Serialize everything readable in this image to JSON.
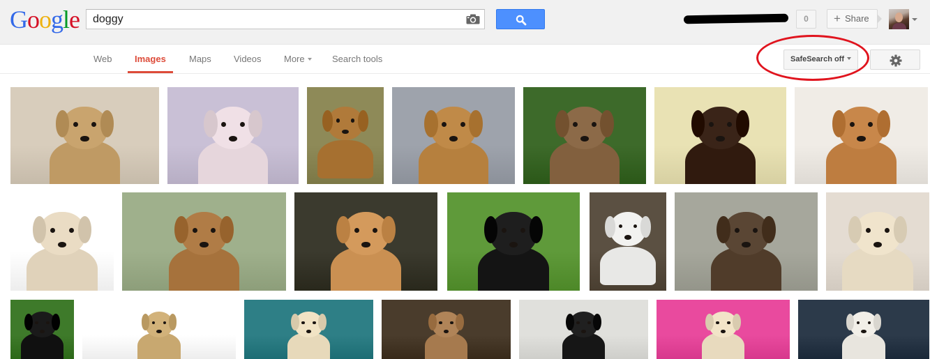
{
  "header": {
    "logo_letters": [
      {
        "ch": "G",
        "color": "#3369e8"
      },
      {
        "ch": "o",
        "color": "#d50f25"
      },
      {
        "ch": "o",
        "color": "#eeb211"
      },
      {
        "ch": "g",
        "color": "#3369e8"
      },
      {
        "ch": "l",
        "color": "#009925"
      },
      {
        "ch": "e",
        "color": "#d50f25"
      }
    ],
    "search_value": "doggy",
    "camera_icon": "camera-icon",
    "search_icon": "magnifier-icon",
    "notification_count": "0",
    "share_label": "Share",
    "accent_color": "#4d90fe"
  },
  "nav": {
    "items": [
      {
        "label": "Web",
        "active": false
      },
      {
        "label": "Images",
        "active": true
      },
      {
        "label": "Maps",
        "active": false
      },
      {
        "label": "Videos",
        "active": false
      },
      {
        "label": "More",
        "active": false,
        "dropdown": true
      },
      {
        "label": "Search tools",
        "active": false
      }
    ],
    "safesearch_label": "SafeSearch off",
    "settings_icon": "gear-icon",
    "highlight_color": "#e0141e"
  },
  "results": [
    {
      "bg": "#d8cdbc",
      "fg": "#c9a46e"
    },
    {
      "bg": "#c9c0d6",
      "fg": "#f0e0e6"
    },
    {
      "bg": "#8e8a58",
      "fg": "#b07a3a"
    },
    {
      "bg": "#9ea3ac",
      "fg": "#c08a48"
    },
    {
      "bg": "#3d6a2a",
      "fg": "#8c6a48"
    },
    {
      "bg": "#e9e2b4",
      "fg": "#3a2418"
    },
    {
      "bg": "#f0ece6",
      "fg": "#c8874a"
    },
    {
      "bg": "#ffffff",
      "fg": "#eadcc4"
    },
    {
      "bg": "#9fb08c",
      "fg": "#b07c46"
    },
    {
      "bg": "#3b3a2e",
      "fg": "#d49a5c"
    },
    {
      "bg": "#5f9a3a",
      "fg": "#1e1e1e"
    },
    {
      "bg": "#5b5042",
      "fg": "#f2f2f0"
    },
    {
      "bg": "#a6a79c",
      "fg": "#5a4634"
    },
    {
      "bg": "#e4dcd2",
      "fg": "#f0e4cc"
    },
    {
      "bg": "#3e7a2a",
      "fg": "#1a1a1a"
    },
    {
      "bg": "#ffffff",
      "fg": "#d2b27a"
    },
    {
      "bg": "#2e7f86",
      "fg": "#f1e3c4"
    },
    {
      "bg": "#4a3c2c",
      "fg": "#b08458"
    },
    {
      "bg": "#e0e0dc",
      "fg": "#202020"
    },
    {
      "bg": "#e94a9e",
      "fg": "#f2e4c8"
    },
    {
      "bg": "#2c3a4a",
      "fg": "#f2efe8"
    }
  ]
}
